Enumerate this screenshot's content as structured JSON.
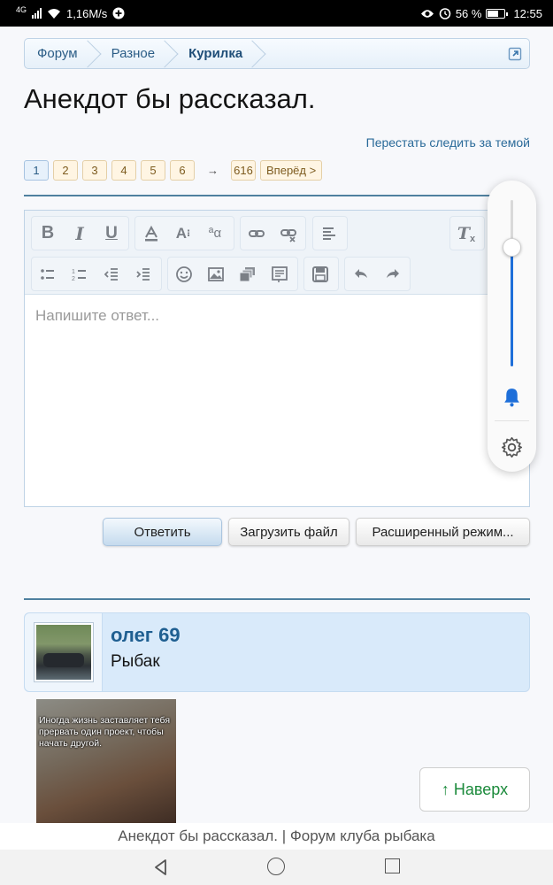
{
  "status_bar": {
    "network": "4G",
    "speed": "1,16M/s",
    "battery_percent": "56 %",
    "battery_level": 0.56,
    "time": "12:55"
  },
  "breadcrumbs": [
    "Форум",
    "Разное",
    "Курилка"
  ],
  "thread": {
    "title": "Анекдот бы рассказал.",
    "unwatch_link": "Перестать следить за темой"
  },
  "pagination": {
    "pages": [
      "1",
      "2",
      "3",
      "4",
      "5",
      "6"
    ],
    "current": "1",
    "arrow": "→",
    "last_page": "616",
    "next_label": "Вперёд >"
  },
  "editor": {
    "placeholder": "Напишите ответ...",
    "toolbar_row1": [
      "bold-icon",
      "italic-icon",
      "underline-icon",
      "text-color-icon",
      "font-size-icon",
      "font-family-icon",
      "link-icon",
      "unlink-icon",
      "align-icon",
      "remove-format-icon"
    ],
    "toolbar_row2": [
      "bullet-list-icon",
      "numbered-list-icon",
      "outdent-icon",
      "indent-icon",
      "smilie-icon",
      "image-icon",
      "media-icon",
      "quote-icon",
      "save-draft-icon",
      "undo-icon",
      "redo-icon"
    ]
  },
  "buttons": {
    "reply": "Ответить",
    "upload": "Загрузить файл",
    "advanced": "Расширенный режим..."
  },
  "volume_overlay": {
    "level": 0.72,
    "ring_icon": "bell-icon",
    "settings_icon": "gear-icon"
  },
  "post": {
    "username": "олег 69",
    "user_title": "Рыбак",
    "image_caption": "Иногда жизнь заставляет тебя прервать один проект, чтобы начать другой."
  },
  "to_top": "↑ Наверх",
  "page_footer_title": "Анекдот бы рассказал. | Форум клуба рыбака",
  "colors": {
    "accent": "#2a5c86",
    "page_bg": "#f7f8fb",
    "pagenav_bg": "#fff5e3",
    "green": "#1b8a3b",
    "volume_blue": "#1e6fd9"
  }
}
